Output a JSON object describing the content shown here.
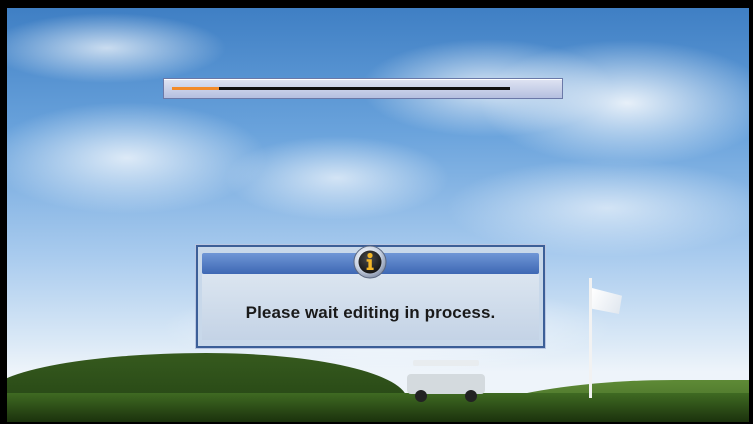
{
  "progress": {
    "fraction": 0.14,
    "fill_color": "#f28b2a",
    "track_color": "#111111"
  },
  "dialog": {
    "icon": "info-icon",
    "message": "Please wait editing in process."
  }
}
